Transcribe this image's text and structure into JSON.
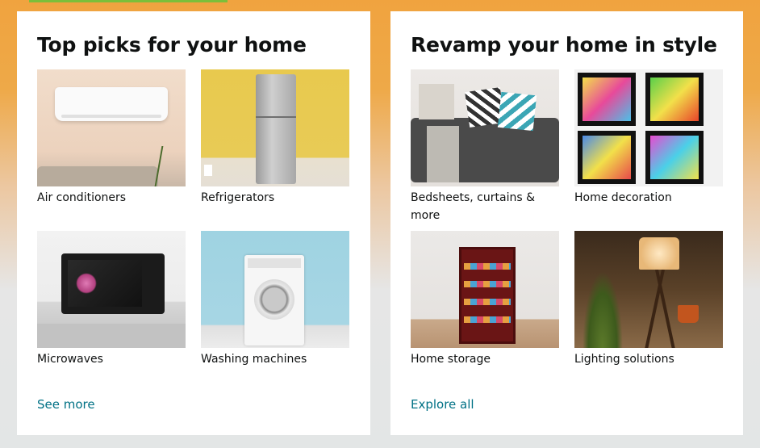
{
  "left_card": {
    "title": "Top picks for your home",
    "tiles": [
      {
        "label": "Air conditioners"
      },
      {
        "label": "Refrigerators"
      },
      {
        "label": "Microwaves"
      },
      {
        "label": "Washing machines"
      }
    ],
    "link": "See more"
  },
  "right_card": {
    "title": "Revamp your home in style",
    "tiles": [
      {
        "label": "Bedsheets, curtains & more"
      },
      {
        "label": "Home decoration"
      },
      {
        "label": "Home storage"
      },
      {
        "label": "Lighting solutions"
      }
    ],
    "link": "Explore all"
  },
  "colors": {
    "link": "#007185",
    "text": "#0f1111",
    "page_top": "#f0a33f",
    "page_bottom": "#e3e6e6"
  }
}
